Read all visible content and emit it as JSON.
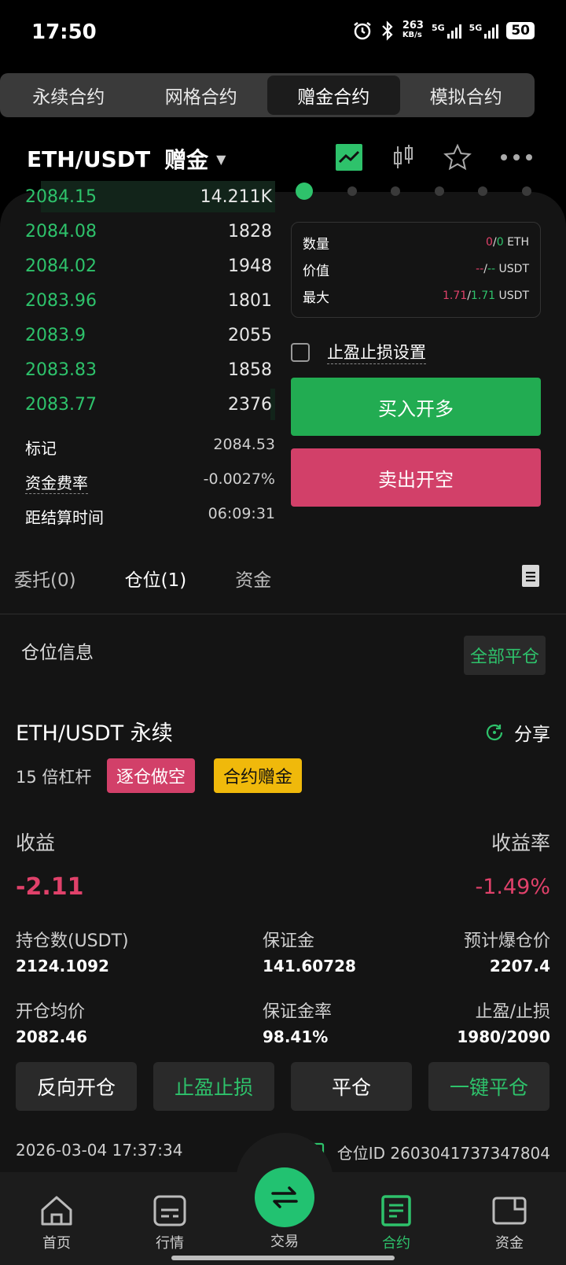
{
  "status": {
    "time": "17:50",
    "speed_top": "263",
    "speed_unit": "KB/s",
    "net1": "5G",
    "net2": "5G",
    "battery": "50"
  },
  "tabs_top": [
    {
      "label": "永续合约"
    },
    {
      "label": "网格合约"
    },
    {
      "label": "赠金合约"
    },
    {
      "label": "模拟合约"
    }
  ],
  "pair": {
    "symbol": "ETH/USDT",
    "mode": "赠金"
  },
  "orderbook": [
    {
      "price": "2084.15",
      "qty": "14.211K",
      "depth": 0.95
    },
    {
      "price": "2084.08",
      "qty": "1828",
      "depth": 0.0
    },
    {
      "price": "2084.02",
      "qty": "1948",
      "depth": 0.0
    },
    {
      "price": "2083.96",
      "qty": "1801",
      "depth": 0.0
    },
    {
      "price": "2083.9",
      "qty": "2055",
      "depth": 0.0
    },
    {
      "price": "2083.83",
      "qty": "1858",
      "depth": 0.0
    },
    {
      "price": "2083.77",
      "qty": "2376",
      "depth": 0.02
    }
  ],
  "market": {
    "mark_label": "标记",
    "mark_value": "2084.53",
    "funding_label": "资金费率",
    "funding_value": "-0.0027%",
    "settle_label": "距结算时间",
    "settle_value": "06:09:31"
  },
  "order": {
    "qty_label": "数量",
    "qty_a": "0",
    "qty_b": "0",
    "qty_unit": "ETH",
    "value_label": "价值",
    "value_a": "--",
    "value_b": "--",
    "value_unit": "USDT",
    "max_label": "最大",
    "max_a": "1.71",
    "max_b": "1.71",
    "max_unit": "USDT",
    "tpsl_label": "止盈止损设置",
    "buy_label": "买入开多",
    "sell_label": "卖出开空"
  },
  "bottom_tabs": {
    "orders": "委托(0)",
    "positions": "仓位(1)",
    "funds": "资金"
  },
  "position": {
    "section_title": "仓位信息",
    "close_all": "全部平仓",
    "title": "ETH/USDT 永续",
    "share": "分享",
    "leverage": "15 倍杠杆",
    "tag_side": "逐仓做空",
    "tag_bonus": "合约赠金",
    "pnl_label": "收益",
    "pnl_value": "-2.11",
    "roe_label": "收益率",
    "roe_value": "-1.49%",
    "size_label": "持仓数(USDT)",
    "size_value": "2124.1092",
    "margin_label": "保证金",
    "margin_value": "141.60728",
    "liq_label": "预计爆仓价",
    "liq_value": "2207.4",
    "entry_label": "开仓均价",
    "entry_value": "2082.46",
    "margin_ratio_label": "保证金率",
    "margin_ratio_value": "98.41%",
    "tpsl_label": "止盈/止损",
    "tpsl_value": "1980/2090",
    "btn_reverse": "反向开仓",
    "btn_tpsl": "止盈止损",
    "btn_close": "平仓",
    "btn_close_all": "一键平仓",
    "timestamp": "2026-03-04 17:37:34",
    "position_id": "仓位ID 2603041737347804"
  },
  "nav": [
    {
      "label": "首页",
      "icon": "home-icon"
    },
    {
      "label": "行情",
      "icon": "market-icon"
    },
    {
      "label": "交易",
      "icon": "trade-icon"
    },
    {
      "label": "合约",
      "icon": "contract-icon"
    },
    {
      "label": "资金",
      "icon": "wallet-icon"
    }
  ],
  "colors": {
    "green": "#2ec26b",
    "red": "#e0416a",
    "yellow": "#f0b90b",
    "bg": "#141414"
  }
}
